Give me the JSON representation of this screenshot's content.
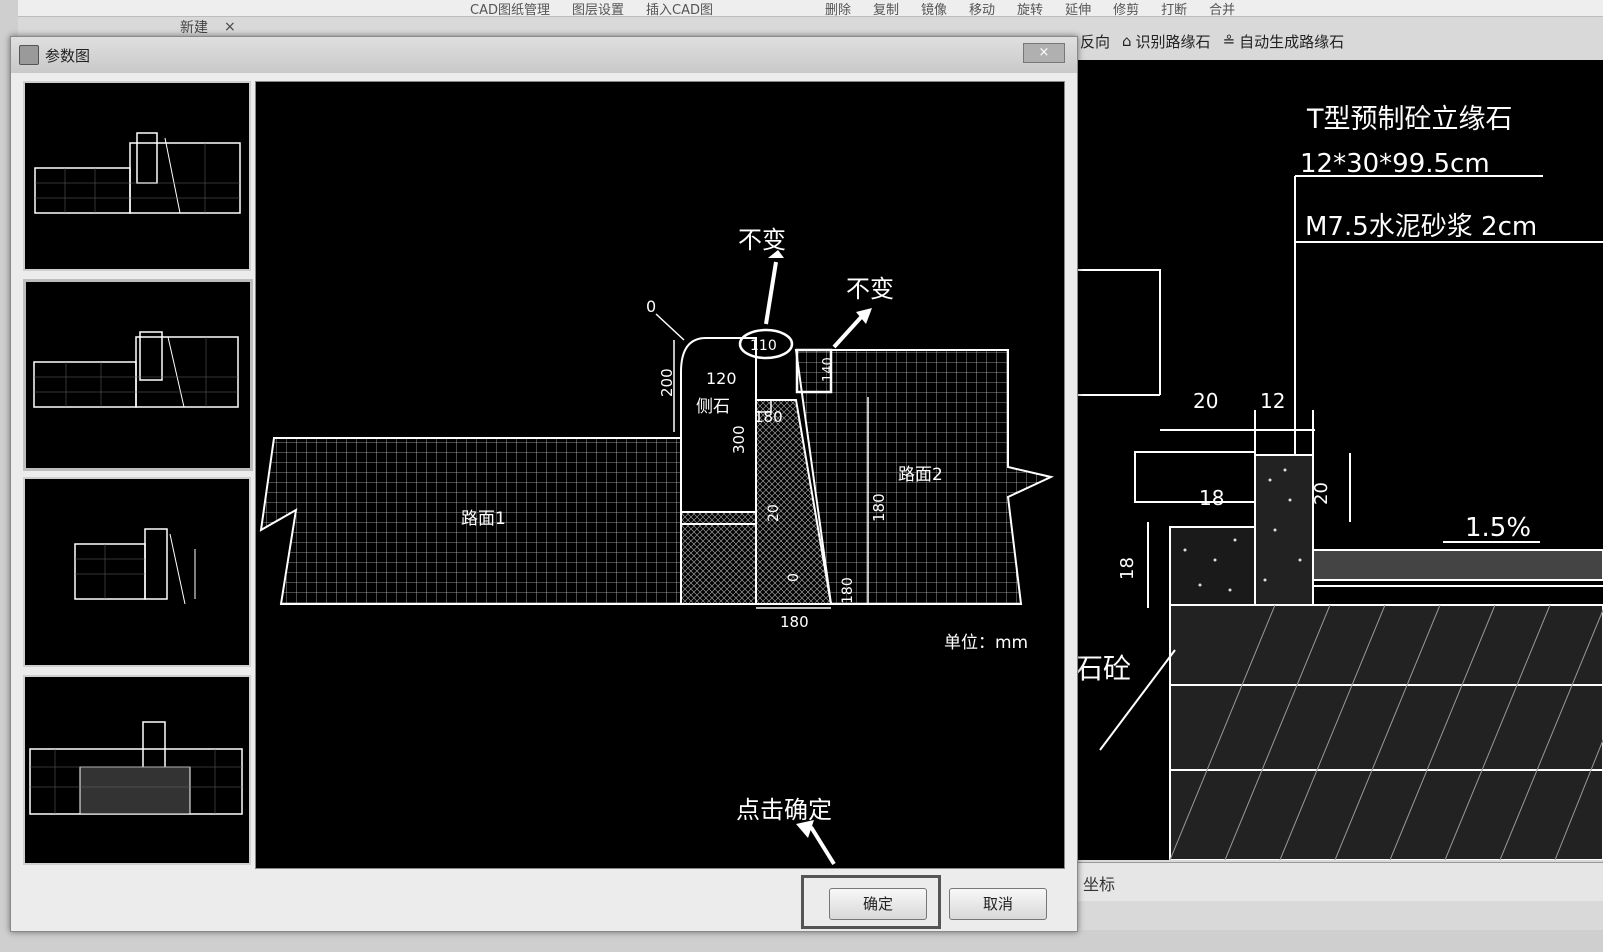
{
  "app": {
    "top_menu": [
      "CAD图纸管理",
      "图层设置",
      "插入CAD图",
      "删除",
      "复制",
      "镜像",
      "移动",
      "旋转",
      "延伸",
      "修剪",
      "打断",
      "合并"
    ],
    "left_tools": [
      "新建",
      "×"
    ],
    "toolbar2": [
      "反向",
      "识别路缘石",
      "自动生成路缘石"
    ],
    "status_label": "坐标"
  },
  "dialog": {
    "title": "参数图",
    "close_label": "×",
    "ok_label": "确定",
    "cancel_label": "取消",
    "selected_thumbnail_index": 1
  },
  "drawing": {
    "pavement1_label": "路面1",
    "pavement2_label": "路面2",
    "curb_label": "侧石",
    "unit_label": "单位：mm",
    "dim_0": "0",
    "dim_200": "200",
    "dim_120": "120",
    "dim_110": "110",
    "dim_140": "140",
    "dim_180_top": "180",
    "dim_300": "300",
    "dim_20": "20",
    "dim_180_right": "180",
    "dim_0_lower": "0",
    "dim_180_bottom_v": "180",
    "dim_180_bottom": "180",
    "annotation_unchanged_1": "不变",
    "annotation_unchanged_2": "不变",
    "annotation_click_ok": "点击确定"
  },
  "right_cad": {
    "title": "T型预制砼立缘石",
    "size": "12*30*99.5cm",
    "mortar": "M7.5水泥砂浆 2cm",
    "dim_20": "20",
    "dim_12": "12",
    "dim_18_h": "18",
    "dim_20_v": "20",
    "dim_18_v": "18",
    "slope": "1.5%",
    "concrete_label": "石砼"
  }
}
